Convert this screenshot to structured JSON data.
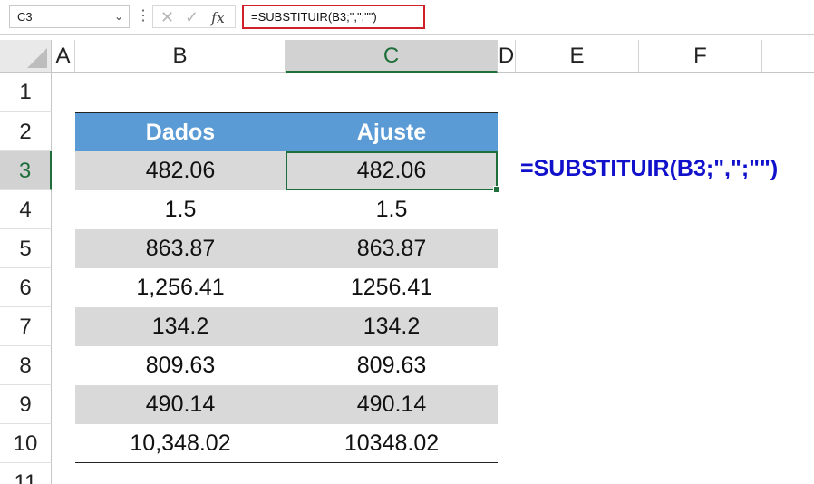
{
  "formula_bar": {
    "name_box": "C3",
    "formula": "=SUBSTITUIR(B3;\",\";\"\")",
    "fx_label": "fx"
  },
  "columns": [
    "A",
    "B",
    "C",
    "D",
    "E",
    "F"
  ],
  "selected_column": "C",
  "rows": [
    "1",
    "2",
    "3",
    "4",
    "5",
    "6",
    "7",
    "8",
    "9",
    "10",
    "11"
  ],
  "selected_row": "3",
  "table": {
    "headers": [
      "Dados",
      "Ajuste"
    ],
    "rows": [
      [
        "482.06",
        "482.06"
      ],
      [
        "1.5",
        "1.5"
      ],
      [
        "863.87",
        "863.87"
      ],
      [
        "1,256.41",
        "1256.41"
      ],
      [
        "134.2",
        "134.2"
      ],
      [
        "809.63",
        "809.63"
      ],
      [
        "490.14",
        "490.14"
      ],
      [
        "10,348.02",
        "10348.02"
      ]
    ]
  },
  "annotation": "=SUBSTITUIR(B3;\",\";\"\")",
  "colors": {
    "header_fill": "#5b9bd5",
    "band_fill": "#d9d9d9",
    "selection": "#1e6f3a",
    "annotation": "#1111cc",
    "formula_highlight": "#d0212b"
  }
}
